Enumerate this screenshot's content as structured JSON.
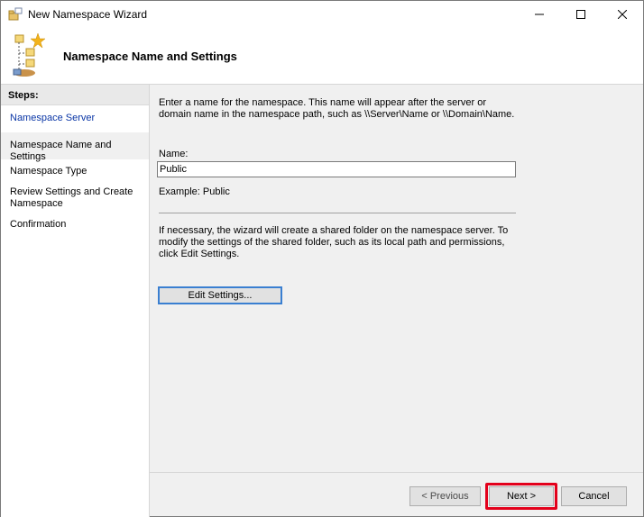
{
  "window": {
    "title": "New Namespace Wizard",
    "controls": {
      "minimize": "minimize-icon",
      "maximize": "maximize-icon",
      "close": "close-icon"
    }
  },
  "header": {
    "title": "Namespace Name and Settings",
    "icon": "namespace-wizard-icon"
  },
  "steps": {
    "heading": "Steps:",
    "items": [
      {
        "label": "Namespace Server",
        "state": "link"
      },
      {
        "label": "Namespace Name and Settings",
        "state": "current"
      },
      {
        "label": "Namespace Type",
        "state": "pending"
      },
      {
        "label": "Review Settings and Create Namespace",
        "state": "pending"
      },
      {
        "label": "Confirmation",
        "state": "pending"
      }
    ]
  },
  "content": {
    "description": "Enter a name for the namespace. This name will appear after the server or domain name in the namespace path, such as \\\\Server\\Name or \\\\Domain\\Name.",
    "name_label": "Name:",
    "name_value": "Public",
    "example": "Example: Public",
    "note": "If necessary, the wizard will create a shared folder on the namespace server. To modify the settings of the shared folder, such as its local path and permissions, click Edit Settings.",
    "edit_settings_label": "Edit Settings..."
  },
  "footer": {
    "previous_label": "< Previous",
    "next_label": "Next >",
    "cancel_label": "Cancel"
  },
  "colors": {
    "link_blue": "#0a36a6",
    "highlight_red": "#e3001b",
    "focus_blue": "#3a7fd1"
  }
}
